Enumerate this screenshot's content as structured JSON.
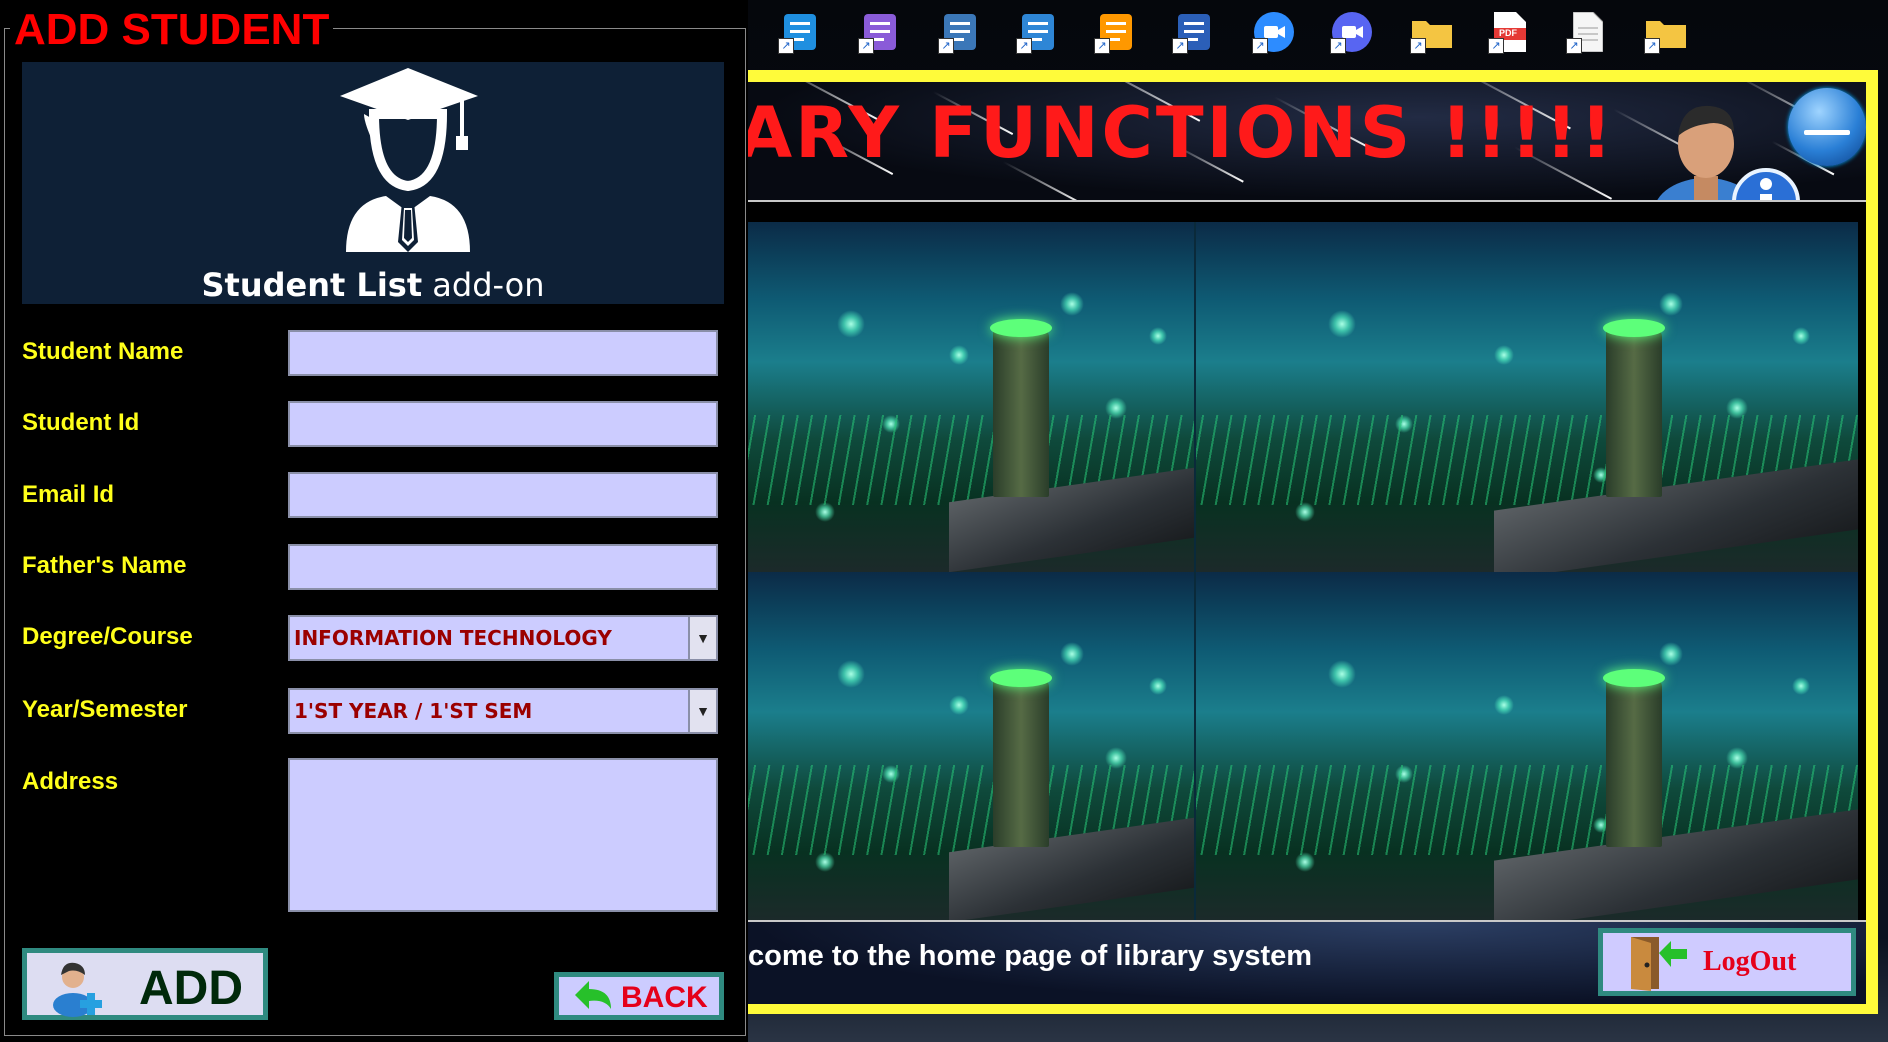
{
  "desktop": {
    "icons": [
      {
        "name": "vscode-icon",
        "color": "#1f8fe0"
      },
      {
        "name": "visual-studio-icon",
        "color": "#8a5bd8"
      },
      {
        "name": "python-file-icon",
        "color": "#3b77b8"
      },
      {
        "name": "notepad-icon",
        "color": "#2e86d6"
      },
      {
        "name": "sublime-text-icon",
        "color": "#ff9800"
      },
      {
        "name": "word-icon",
        "color": "#2b5fb8"
      },
      {
        "name": "zoom-icon",
        "color": "#2d8cff"
      },
      {
        "name": "discord-icon",
        "color": "#5865f2"
      },
      {
        "name": "folder-icon",
        "color": "#f4c542"
      },
      {
        "name": "pdf-icon",
        "color": "#e53935"
      },
      {
        "name": "text-file-icon",
        "color": "#f5f5f5"
      },
      {
        "name": "folder-icon",
        "color": "#f4c542"
      }
    ],
    "pdf_label": "PDF"
  },
  "main_window": {
    "banner_title": "ARY  FUNCTIONS !!!!!",
    "welcome_text": "come to the home page of library system",
    "logout_label": "LogOut",
    "accent_color": "#fffb3a"
  },
  "add_student": {
    "title": "ADD STUDENT",
    "header": {
      "caption_bold": "Student List",
      "caption_rest": " add-on"
    },
    "fields": {
      "student_name": {
        "label": " Student  Name",
        "value": ""
      },
      "student_id": {
        "label": " Student Id",
        "value": ""
      },
      "email_id": {
        "label": "Email  Id",
        "value": ""
      },
      "fathers_name": {
        "label": "Father's  Name",
        "value": ""
      },
      "degree_course": {
        "label": "Degree/Course",
        "value": "INFORMATION TECHNOLOGY"
      },
      "year_semester": {
        "label": "Year/Semester",
        "value": "1'ST YEAR / 1'ST SEM"
      },
      "address": {
        "label": "Address",
        "value": ""
      }
    },
    "add_label": "ADD",
    "back_label": "BACK"
  }
}
